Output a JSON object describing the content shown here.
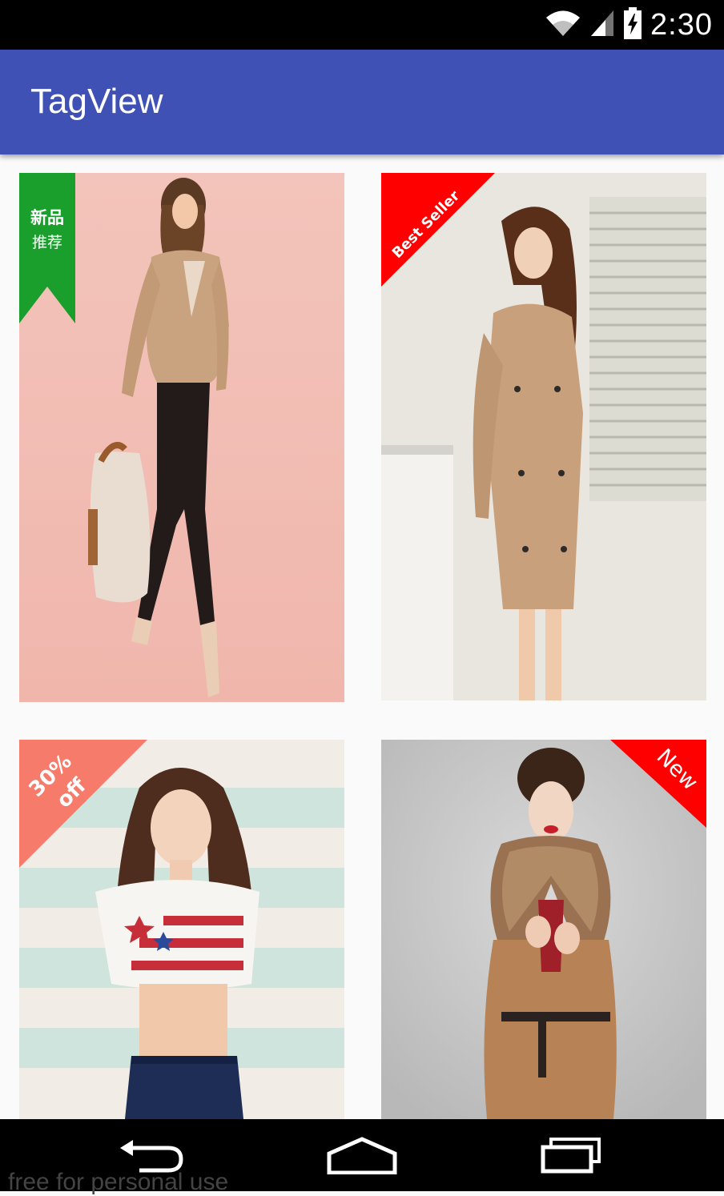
{
  "status_bar": {
    "time": "2:30",
    "icons": [
      "wifi-icon",
      "signal-icon",
      "battery-charging-icon"
    ]
  },
  "app_bar": {
    "title": "TagView",
    "color": "#3f51b5"
  },
  "cards": [
    {
      "name": "card-beige-blazer",
      "tag_style": "ribbon",
      "tag_color": "#1a9e2c",
      "tag_line1": "新品",
      "tag_line2": "推荐"
    },
    {
      "name": "card-trench-coat",
      "tag_style": "corner-left",
      "tag_color": "#ff0000",
      "tag_text": "Best Seller"
    },
    {
      "name": "card-flag-top",
      "tag_style": "corner-left",
      "tag_color": "#f77b6a",
      "tag_line1": "30%",
      "tag_line2": "off"
    },
    {
      "name": "card-fur-coat",
      "tag_style": "corner-right",
      "tag_color": "#ff0000",
      "tag_text": "New"
    }
  ],
  "nav_bar": {
    "buttons": [
      "back-icon",
      "home-icon",
      "recents-icon"
    ]
  },
  "watermark": "free for personal use"
}
